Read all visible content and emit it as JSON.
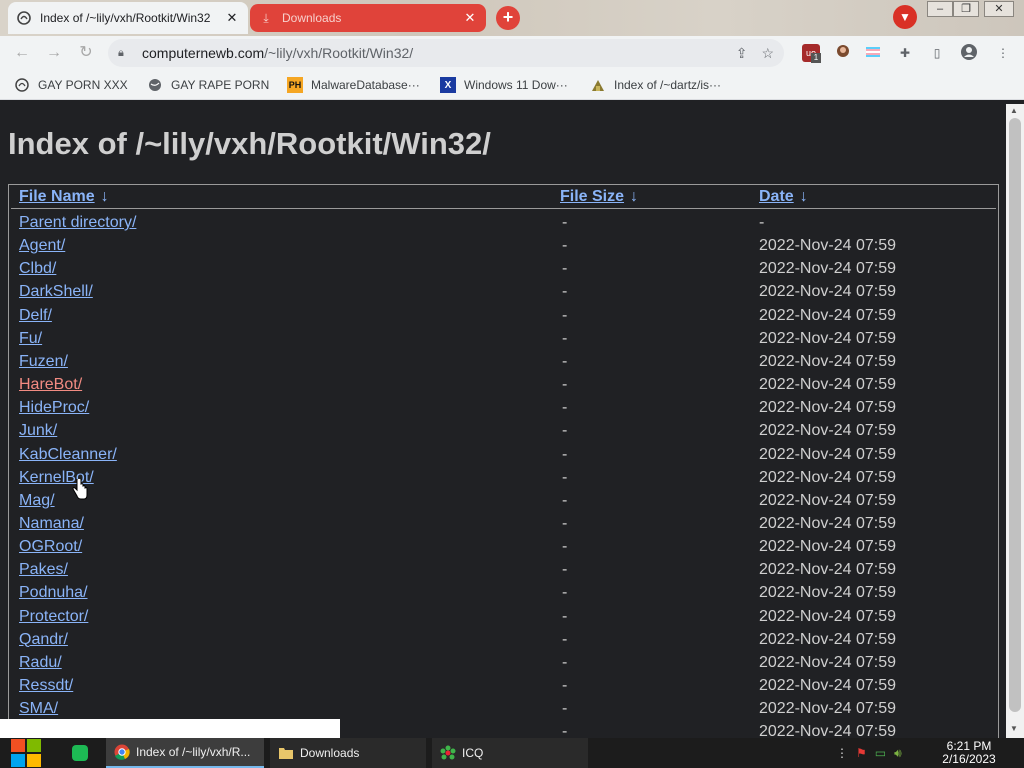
{
  "browser": {
    "tabs": [
      {
        "title": "Index of /~lily/vxh/Rootkit/Win32",
        "active": true
      },
      {
        "title": "Downloads",
        "active": false
      }
    ],
    "new_tab_glyph": "+",
    "url_host": "computernewb.com",
    "url_path": "/~lily/vxh/Rootkit/Win32/",
    "bookmarks": [
      "GAY PORN XXX",
      "GAY RAPE PORN",
      "MalwareDatabase···",
      "Windows 11 Dow···",
      "Index of /~dartz/is···"
    ],
    "bookmark_icons": [
      "PH",
      "X"
    ],
    "extension_badge": "1",
    "extension_label": "uo"
  },
  "page": {
    "title": "Index of /~lily/vxh/Rootkit/Win32/",
    "columns": {
      "name": "File Name",
      "size": "File Size",
      "date": "Date",
      "sort_arrow": "↓"
    },
    "rows": [
      {
        "name": "Parent directory/",
        "size": "-",
        "date": "-"
      },
      {
        "name": "Agent/",
        "size": "-",
        "date": "2022-Nov-24 07:59"
      },
      {
        "name": "Clbd/",
        "size": "-",
        "date": "2022-Nov-24 07:59"
      },
      {
        "name": "DarkShell/",
        "size": "-",
        "date": "2022-Nov-24 07:59"
      },
      {
        "name": "Delf/",
        "size": "-",
        "date": "2022-Nov-24 07:59"
      },
      {
        "name": "Fu/",
        "size": "-",
        "date": "2022-Nov-24 07:59"
      },
      {
        "name": "Fuzen/",
        "size": "-",
        "date": "2022-Nov-24 07:59"
      },
      {
        "name": "HareBot/",
        "size": "-",
        "date": "2022-Nov-24 07:59",
        "hover": true
      },
      {
        "name": "HideProc/",
        "size": "-",
        "date": "2022-Nov-24 07:59"
      },
      {
        "name": "Junk/",
        "size": "-",
        "date": "2022-Nov-24 07:59"
      },
      {
        "name": "KabCleanner/",
        "size": "-",
        "date": "2022-Nov-24 07:59"
      },
      {
        "name": "KernelBot/",
        "size": "-",
        "date": "2022-Nov-24 07:59"
      },
      {
        "name": "Mag/",
        "size": "-",
        "date": "2022-Nov-24 07:59"
      },
      {
        "name": "Namana/",
        "size": "-",
        "date": "2022-Nov-24 07:59"
      },
      {
        "name": "OGRoot/",
        "size": "-",
        "date": "2022-Nov-24 07:59"
      },
      {
        "name": "Pakes/",
        "size": "-",
        "date": "2022-Nov-24 07:59"
      },
      {
        "name": "Podnuha/",
        "size": "-",
        "date": "2022-Nov-24 07:59"
      },
      {
        "name": "Protector/",
        "size": "-",
        "date": "2022-Nov-24 07:59"
      },
      {
        "name": "Qandr/",
        "size": "-",
        "date": "2022-Nov-24 07:59"
      },
      {
        "name": "Radu/",
        "size": "-",
        "date": "2022-Nov-24 07:59"
      },
      {
        "name": "Ressdt/",
        "size": "-",
        "date": "2022-Nov-24 07:59"
      },
      {
        "name": "SMA/",
        "size": "-",
        "date": "2022-Nov-24 07:59"
      },
      {
        "name": "",
        "size": "-",
        "date": "2022-Nov-24 07:59"
      }
    ]
  },
  "taskbar": {
    "apps": [
      {
        "label": "Index of /~lily/vxh/R...",
        "icon": "chrome-icon"
      },
      {
        "label": "Downloads",
        "icon": "folder-icon"
      },
      {
        "label": "ICQ",
        "icon": "icq-icon"
      }
    ],
    "time": "6:21 PM",
    "date": "2/16/2023"
  },
  "colors": {
    "link": "#8ab4f8",
    "link_hover": "#f28b82",
    "page_bg": "#202124",
    "text": "#cfcfcf",
    "downloads_tab": "#e0433a"
  }
}
